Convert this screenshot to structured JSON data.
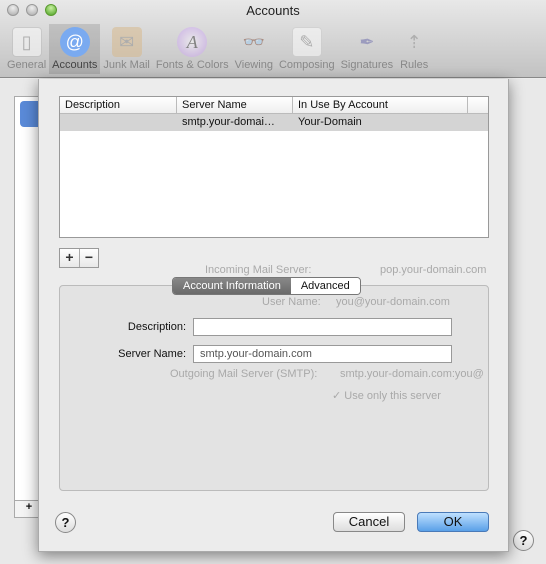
{
  "window": {
    "title": "Accounts"
  },
  "toolbar": [
    {
      "label": "General",
      "icon": "switch-icon"
    },
    {
      "label": "Accounts",
      "icon": "at-icon",
      "active": true
    },
    {
      "label": "Junk Mail",
      "icon": "junk-mail-icon"
    },
    {
      "label": "Fonts & Colors",
      "icon": "fonts-icon"
    },
    {
      "label": "Viewing",
      "icon": "viewing-icon"
    },
    {
      "label": "Composing",
      "icon": "composing-icon"
    },
    {
      "label": "Signatures",
      "icon": "signatures-icon"
    },
    {
      "label": "Rules",
      "icon": "rules-icon"
    }
  ],
  "background": {
    "incoming": "Incoming Mail Server:",
    "incoming_value": "pop.your-domain.com",
    "user": "User Name:",
    "user_value": "you@your-domain.com",
    "outgoing": "Outgoing Mail Server (SMTP):",
    "outgoing_value": "smtp.your-domain.com:you@",
    "use_only": "✓ Use only this server",
    "add": "+",
    "help": "?"
  },
  "table": {
    "columns": [
      "Description",
      "Server Name",
      "In Use By Account"
    ],
    "rows": [
      {
        "description": "",
        "server": "smtp.your-domai…",
        "account": "Your-Domain"
      }
    ]
  },
  "controls": {
    "add": "+",
    "remove": "−"
  },
  "tabs": {
    "account_info": "Account Information",
    "advanced": "Advanced"
  },
  "form": {
    "description_label": "Description:",
    "description_value": "",
    "server_label": "Server Name:",
    "server_value": "smtp.your-domain.com"
  },
  "buttons": {
    "cancel": "Cancel",
    "ok": "OK",
    "help": "?"
  }
}
